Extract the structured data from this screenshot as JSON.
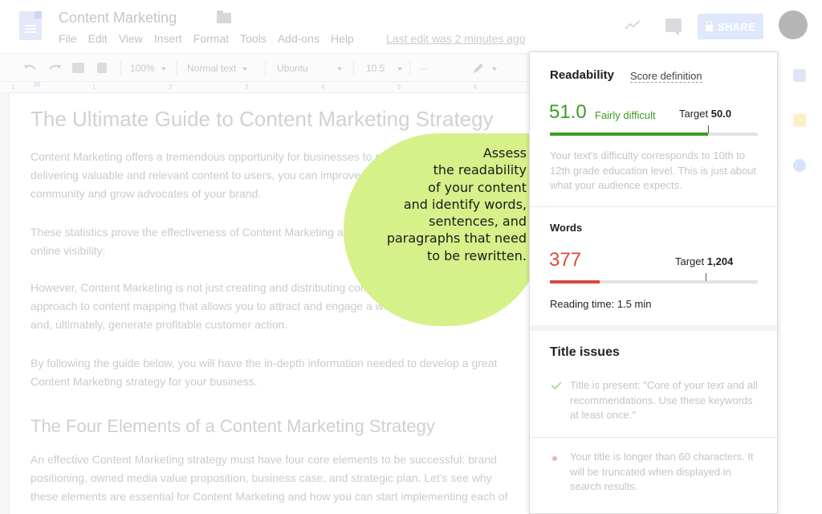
{
  "header": {
    "doc_title": "Content Marketing",
    "menu": [
      "File",
      "Edit",
      "View",
      "Insert",
      "Format",
      "Tools",
      "Add-ons",
      "Help"
    ],
    "last_edit": "Last edit was 2 minutes ago",
    "share_label": "SHARE"
  },
  "toolbar": {
    "zoom": "100%",
    "style": "Normal text",
    "font": "Ubuntu",
    "size": "10.5",
    "more": "···"
  },
  "ruler": {
    "marks": [
      "1",
      "1",
      "2",
      "3",
      "4",
      "5",
      "6"
    ]
  },
  "document": {
    "heading1": "The Ultimate Guide to Content Marketing Strategy",
    "paragraphs": [
      [
        "Content Marketing offers a tremendous opportunity for businesses to reach",
        "delivering valuable and relevant content to users, you can improve",
        "community and grow advocates of your brand."
      ],
      [
        "These statistics prove the effectiveness of Content Marketing and",
        "online visibility:"
      ],
      [
        "However, Content Marketing is not just creating and distributing content",
        "approach to content mapping that allows you to attract and engage a well-defined audience",
        "and, ultimately, generate profitable customer action."
      ],
      [
        "By following the guide below, you will have the in-depth information needed to develop a great",
        "Content Marketing strategy for your business."
      ]
    ],
    "heading2": "The Four Elements of a Content Marketing Strategy",
    "paragraph_last": [
      "An effective Content Marketing strategy must have four core elements to be successful: brand",
      "positioning, owned media value proposition, business case, and strategic plan. Let's see why",
      "these elements are essential for Content Marketing and how you can start implementing each of"
    ]
  },
  "callout": {
    "lines": [
      "Assess",
      "the readability",
      "of your content",
      "and identify words,",
      "sentences, and",
      "paragraphs that need",
      "to be rewritten."
    ],
    "color": "#d6f08a"
  },
  "panel": {
    "readability": {
      "title": "Readability",
      "score_link": "Score definition",
      "score": "51.0",
      "label": "Fairly difficult",
      "target_label": "Target",
      "target_value": "50.0",
      "progress": 0.76,
      "target_pos": 0.76,
      "color": "#3a9d23",
      "description": "Your text's difficulty corresponds to 10th to 12th grade education level. This is just about what your audience expects."
    },
    "words": {
      "title": "Words",
      "count": "377",
      "target_label": "Target",
      "target_value": "1,204",
      "progress": 0.24,
      "target_pos": 0.75,
      "color": "#d9493c",
      "reading_time": "Reading time: 1.5 min"
    },
    "title_issues": {
      "title": "Title issues",
      "items": [
        "Title is present: \"Core of your text and all recommendations. Use these keywords at least once.\"",
        "Your title is longer than 60 characters. It will be truncated when displayed in search results."
      ]
    }
  }
}
